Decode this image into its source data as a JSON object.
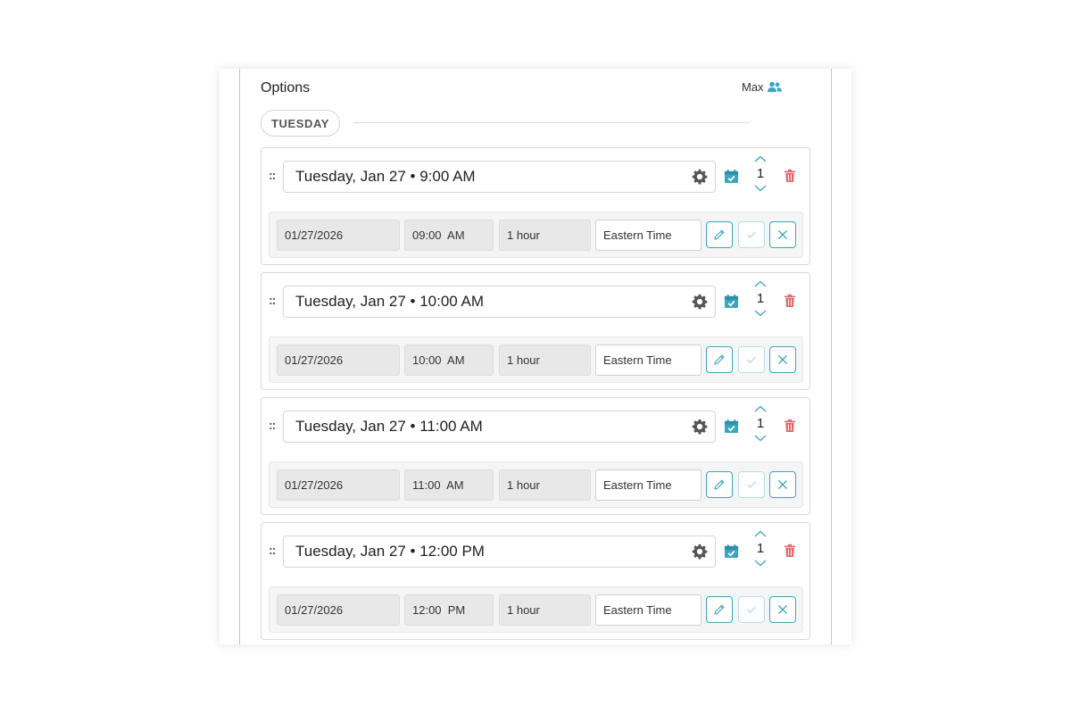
{
  "header": {
    "title": "Options",
    "max_label": "Max"
  },
  "day_group": {
    "label": "TUESDAY"
  },
  "colors": {
    "accent": "#3aa6bf",
    "delete": "#e06a6a",
    "panel_border": "#9fd3e0"
  },
  "icons": {
    "drag": "drag-handle-icon",
    "settings": "gear-icon",
    "calendar": "calendar-icon",
    "increment": "chevron-up-icon",
    "decrement": "chevron-down-icon",
    "delete": "trash-icon",
    "edit": "pencil-icon",
    "confirm": "check-icon",
    "cancel": "close-icon",
    "max": "users-icon"
  },
  "slots": [
    {
      "title": "Tuesday, Jan 27 • 9:00 AM",
      "count": "1",
      "date": "01/27/2026",
      "time": "09:00  AM",
      "duration": "1 hour",
      "timezone": "Eastern Time"
    },
    {
      "title": "Tuesday, Jan 27 • 10:00 AM",
      "count": "1",
      "date": "01/27/2026",
      "time": "10:00  AM",
      "duration": "1 hour",
      "timezone": "Eastern Time"
    },
    {
      "title": "Tuesday, Jan 27 • 11:00 AM",
      "count": "1",
      "date": "01/27/2026",
      "time": "11:00  AM",
      "duration": "1 hour",
      "timezone": "Eastern Time"
    },
    {
      "title": "Tuesday, Jan 27 • 12:00 PM",
      "count": "1",
      "date": "01/27/2026",
      "time": "12:00  PM",
      "duration": "1 hour",
      "timezone": "Eastern Time"
    }
  ]
}
